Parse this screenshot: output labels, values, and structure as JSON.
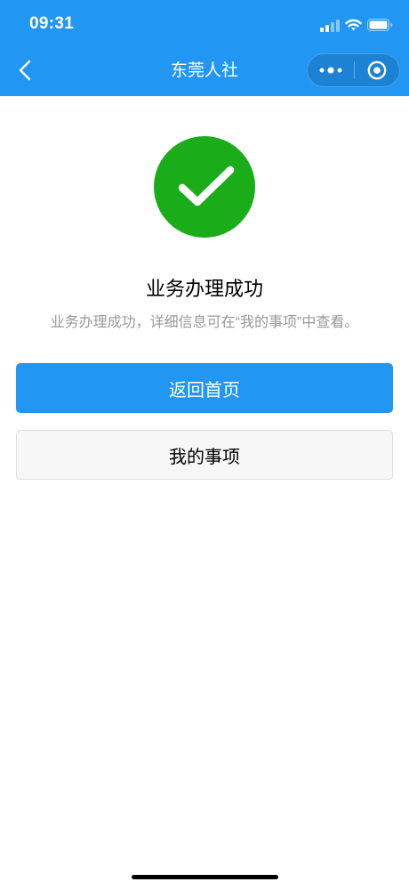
{
  "status_bar": {
    "time": "09:31",
    "signal_strength": 2,
    "signal_max": 4,
    "battery_level": 1.0,
    "icons": [
      "signal-icon",
      "wifi-icon",
      "battery-icon"
    ]
  },
  "nav_bar": {
    "title": "东莞人社",
    "back_icon": "chevron-left-icon",
    "capsule": {
      "more_icon": "more-dots-icon",
      "close_icon": "target-circle-icon"
    }
  },
  "result": {
    "icon": "success-check-icon",
    "title": "业务办理成功",
    "description": "业务办理成功，详细信息可在“我的事项”中查看。"
  },
  "actions": {
    "primary_label": "返回首页",
    "secondary_label": "我的事项"
  },
  "colors": {
    "primary": "#2196F3",
    "success": "#1AAD19",
    "text": "#000000",
    "subtext": "#999999"
  }
}
